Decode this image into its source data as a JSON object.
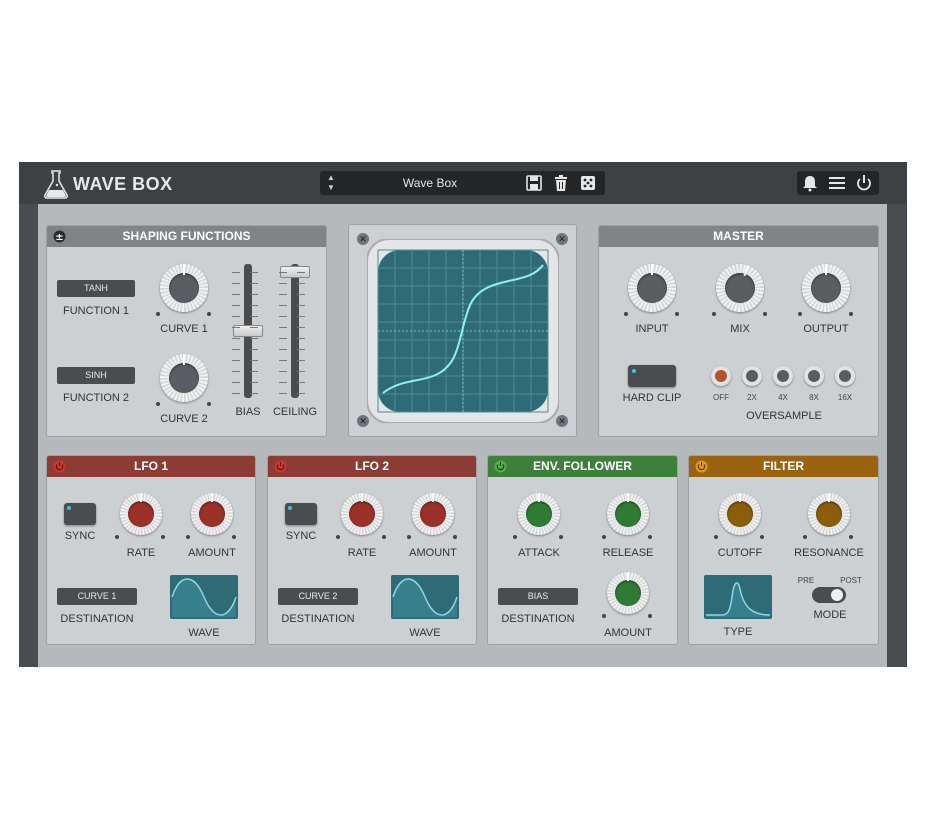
{
  "app": {
    "title": "WAVE BOX"
  },
  "preset": {
    "name": "Wave Box"
  },
  "shaping": {
    "title": "SHAPING FUNCTIONS",
    "function1": {
      "value": "TANH",
      "label": "FUNCTION 1"
    },
    "function2": {
      "value": "SINH",
      "label": "FUNCTION 2"
    },
    "curve1_label": "CURVE 1",
    "curve2_label": "CURVE 2",
    "bias_label": "BIAS",
    "ceiling_label": "CEILING"
  },
  "master": {
    "title": "MASTER",
    "input_label": "INPUT",
    "mix_label": "MIX",
    "output_label": "OUTPUT",
    "hardclip_label": "HARD CLIP",
    "oversample_label": "OVERSAMPLE",
    "oversample_options": [
      "OFF",
      "2X",
      "4X",
      "8X",
      "16X"
    ],
    "oversample_selected": "OFF"
  },
  "lfo1": {
    "title": "LFO 1",
    "sync_label": "SYNC",
    "rate_label": "RATE",
    "amount_label": "AMOUNT",
    "destination_value": "CURVE 1",
    "destination_label": "DESTINATION",
    "wave_label": "WAVE"
  },
  "lfo2": {
    "title": "LFO 2",
    "sync_label": "SYNC",
    "rate_label": "RATE",
    "amount_label": "AMOUNT",
    "destination_value": "CURVE 2",
    "destination_label": "DESTINATION",
    "wave_label": "WAVE"
  },
  "env": {
    "title": "ENV. FOLLOWER",
    "attack_label": "ATTACK",
    "release_label": "RELEASE",
    "destination_value": "BIAS",
    "destination_label": "DESTINATION",
    "amount_label": "AMOUNT"
  },
  "filter": {
    "title": "FILTER",
    "cutoff_label": "CUTOFF",
    "resonance_label": "RESONANCE",
    "type_label": "TYPE",
    "pre_label": "PRE",
    "post_label": "POST",
    "mode_label": "MODE"
  },
  "colors": {
    "background": "#b6b9bb",
    "lfo_accent": "#8c3c35",
    "env_accent": "#3f7f3c",
    "filter_accent": "#9a6310",
    "scope_screen": "#2f6a77",
    "scope_trace": "#8ef0f0"
  }
}
